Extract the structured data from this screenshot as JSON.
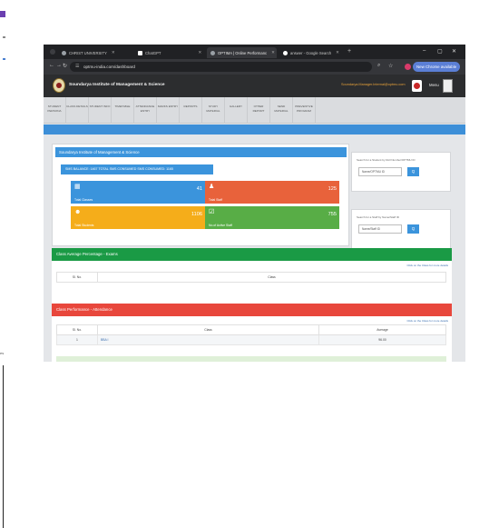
{
  "browser": {
    "tabs": [
      {
        "label": "CHRIST UNIVERSITY",
        "icon": "circle-icon"
      },
      {
        "label": "ChatGPT",
        "icon": "chatgpt-icon"
      },
      {
        "label": "OPTIMA | Online Performanc",
        "icon": "circle-icon",
        "active": true
      },
      {
        "label": "answer - Google Search",
        "icon": "google-icon"
      }
    ],
    "new_tab": "+",
    "url": "optmu-india.com/dashboard",
    "new_chrome_label": "New Chrome available",
    "window_controls": {
      "minimize": "–",
      "maximize": "▢",
      "close": "✕"
    }
  },
  "header": {
    "institute_name": "Soundarya Institute of Management & Science",
    "user_email": "Soundarya.Manager.Internal@optmu.com",
    "menu_label": "Menu"
  },
  "menu": {
    "items": [
      "STUDENT PERSONA",
      "CLASS DETAILS",
      "STUDENT INFO",
      "TIMETABLE",
      "ATTENDANCE ENTRY",
      "MARKS ENTRY",
      "REPORTS",
      "STUDY MATERIAL",
      "GALLERY",
      "OTHER REPORT",
      "SEND MATERIAL",
      "PREVENTIVE PROGRAM"
    ]
  },
  "dashboard": {
    "card_title": "Soundarya Institute of Management & Science",
    "sms_info": "SMS BALANCE: 1467   TOTAL SMS CONSUMED   SMS CONSUMED: 1165",
    "tiles": [
      {
        "label": "Total Classes",
        "count": "41",
        "icon": "grid-icon",
        "color": "#3b94dc"
      },
      {
        "label": "Total Staff",
        "count": "125",
        "icon": "person-icon",
        "color": "#e8623b"
      },
      {
        "label": "Total Students",
        "count": "1106",
        "icon": "student-icon",
        "color": "#f5ad1a"
      },
      {
        "label": "No.of Active Staff",
        "count": "755",
        "icon": "check-icon",
        "color": "#58ad46"
      }
    ]
  },
  "search_cards": [
    {
      "label": "Search for a Student by Roll Number/OPTMU ID",
      "placeholder": "Name/OPTMU ID",
      "button": "Q"
    },
    {
      "label": "Search for a Staff by Name/Staff ID",
      "placeholder": "Name/Staff ID",
      "button": "Q"
    }
  ],
  "panels": [
    {
      "title": "Class Average Percentage - Exams",
      "link": "Click on the Class for more details",
      "columns": [
        "Sl. No.",
        "Class"
      ],
      "rows": []
    },
    {
      "title": "Class Performance - Attendance",
      "link": "Click on the Class for more details",
      "columns": [
        "Sl. No.",
        "Class",
        "Average"
      ],
      "rows": [
        {
          "sl": "1",
          "class": "BBA I",
          "average": "96.00"
        }
      ]
    }
  ],
  "edge": {
    "left_word": "es"
  }
}
